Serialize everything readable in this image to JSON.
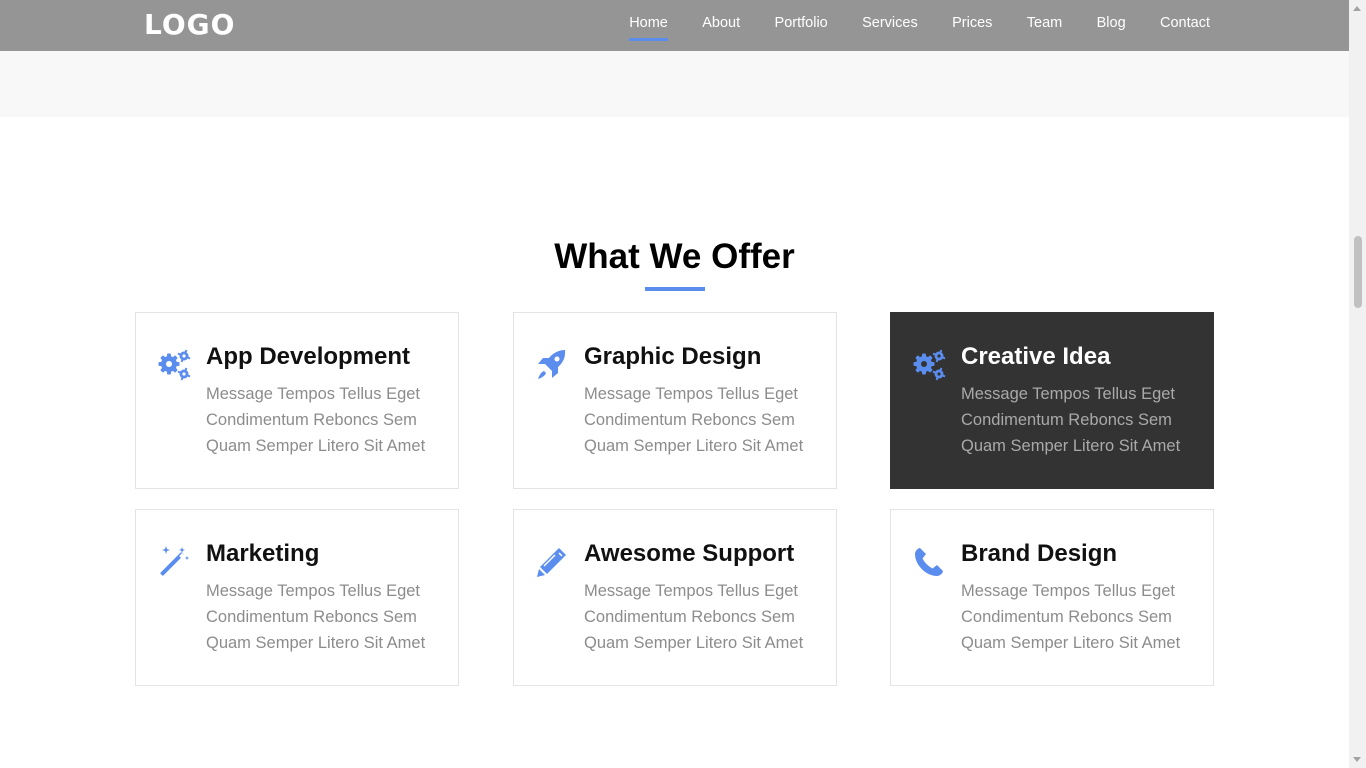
{
  "header": {
    "logo": "LOGO",
    "nav": [
      {
        "label": "Home",
        "active": true
      },
      {
        "label": "About"
      },
      {
        "label": "Portfolio"
      },
      {
        "label": "Services"
      },
      {
        "label": "Prices"
      },
      {
        "label": "Team"
      },
      {
        "label": "Blog"
      },
      {
        "label": "Contact"
      }
    ]
  },
  "offer": {
    "title": "What We Offer",
    "cards": [
      {
        "icon": "gears-icon",
        "title": "App Development",
        "text": "Message Tempos Tellus Eget Condimentum Reboncs Sem Quam Semper Litero Sit Amet",
        "highlighted": false
      },
      {
        "icon": "rocket-icon",
        "title": "Graphic Design",
        "text": "Message Tempos Tellus Eget Condimentum Reboncs Sem Quam Semper Litero Sit Amet",
        "highlighted": false
      },
      {
        "icon": "gears-icon",
        "title": "Creative Idea",
        "text": "Message Tempos Tellus Eget Condimentum Reboncs Sem Quam Semper Litero Sit Amet",
        "highlighted": true
      },
      {
        "icon": "magic-wand-icon",
        "title": "Marketing",
        "text": "Message Tempos Tellus Eget Condimentum Reboncs Sem Quam Semper Litero Sit Amet",
        "highlighted": false
      },
      {
        "icon": "pencil-icon",
        "title": "Awesome Support",
        "text": "Message Tempos Tellus Eget Condimentum Reboncs Sem Quam Semper Litero Sit Amet",
        "highlighted": false
      },
      {
        "icon": "phone-icon",
        "title": "Brand Design",
        "text": "Message Tempos Tellus Eget Condimentum Reboncs Sem Quam Semper Litero Sit Amet",
        "highlighted": false
      }
    ]
  },
  "colors": {
    "accent": "#5b8def",
    "navbar": "#959595",
    "highlight_card": "#333333"
  }
}
